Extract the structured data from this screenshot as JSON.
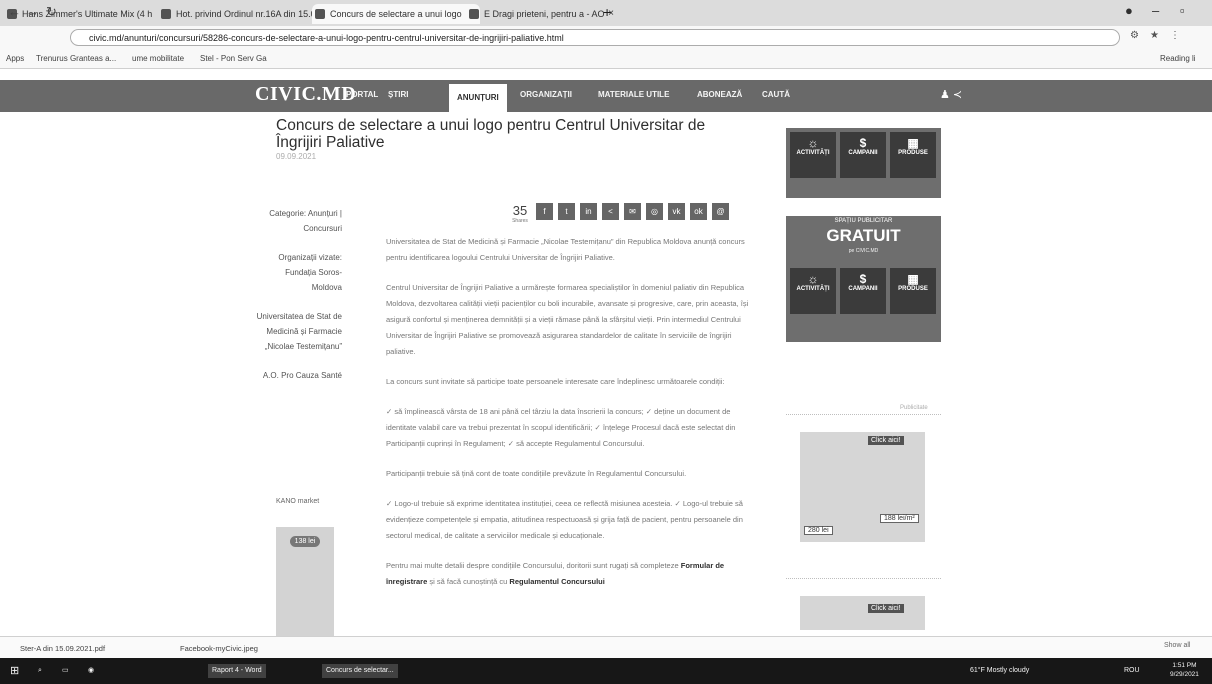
{
  "browser": {
    "tabs": [
      {
        "label": "Hans Zimmer's Ultimate Mix (4 h"
      },
      {
        "label": "Hot. privind Ordinul nr.16A din 15.0"
      },
      {
        "label": "Concurs de selectare a unui logo"
      },
      {
        "label": "E Dragi prieteni, pentru a - AO"
      }
    ],
    "new_tab": "+",
    "url": "civic.md/anunturi/concursuri/58286-concurs-de-selectare-a-unui-logo-pentru-centrul-universitar-de-ingrijiri-paliative.html",
    "bookmarks": [
      "Apps",
      "Trenurus Granteas a...",
      "ume mobilitate",
      "Stel - Pon Serv Ga"
    ],
    "reading_list": "Reading li"
  },
  "site": {
    "logo": "CIVIC.MD",
    "nav": [
      "PORTAL",
      "ȘTIRI",
      "ANUNȚURI",
      "ORGANIZAȚII",
      "MATERIALE UTILE",
      "ABONEAZĂ",
      "CAUTĂ"
    ],
    "icons": "♟ ≺"
  },
  "article": {
    "title": "Concurs de selectare a unui logo pentru Centrul Universitar de Îngrijiri Paliative",
    "date": "09.09.2021",
    "meta": [
      {
        "text": "Categorie: Anunțuri | Concursuri"
      },
      {
        "text": "Organizații vizate: Fundația Soros-Moldova"
      },
      {
        "text": "Universitatea de Stat de Medicină și Farmacie „Nicolae Testemițanu”"
      },
      {
        "text": "A.O. Pro Cauza Santé"
      }
    ],
    "share_count": "35",
    "share_label": "Shares",
    "share_buttons": [
      "f",
      "t",
      "in",
      "<",
      "✉",
      "◎",
      "vk",
      "ok",
      "@"
    ],
    "paragraphs": [
      "Universitatea de Stat de Medicină și Farmacie „Nicolae Testemițanu” din Republica Moldova anunță concurs pentru identificarea logoului Centrului Universitar de Îngrijiri Paliative.",
      "Centrul Universitar de Îngrijiri Paliative a urmărește formarea specialiștilor în domeniul paliativ din Republica Moldova, dezvoltarea calității vieții pacienților cu boli incurabile, avansate și progresive, care, prin aceasta, își asigură confortul și menținerea demnității și a vieții rămase până la sfârșitul vieții. Prin intermediul Centrului Universitar de Îngrijiri Paliative se promovează asigurarea standardelor de calitate în serviciile de îngrijiri paliative.",
      "La concurs sunt invitate să participe toate persoanele interesate care îndeplinesc următoarele condiții:",
      "✓ să împlinească vârsta de 18 ani până cel târziu la data înscrierii la concurs; ✓ deține un document de identitate valabil care va trebui prezentat în scopul identificării; ✓ înțelege Procesul dacă este selectat din Participanții cuprinși în Regulament; ✓ să accepte Regulamentul Concursului.",
      "Participanții trebuie să țină cont de toate condițiile prevăzute în Regulamentul Concursului.",
      "✓ Logo-ul trebuie să exprime identitatea instituției, ceea ce reflectă misiunea acesteia. ✓ Logo-ul trebuie să evidențieze competențele și empatia, atitudinea respectuoasă și grija față de pacient, pentru persoanele din sectorul medical, de calitate a serviciilor medicale și educaționale."
    ],
    "closing_pre": "Pentru mai multe detalii despre condițiile Concursului, doritorii sunt rugați să completeze ",
    "closing_link1": "Formular de înregistrare",
    "closing_mid": " și să facă cunoștință cu ",
    "closing_link2": "Regulamentul Concursului"
  },
  "ads": {
    "top_cards": [
      "ACTIVITĂȚI",
      "CAMPANII",
      "PRODUSE"
    ],
    "promo_head": "SPAȚIU PUBLICITAR",
    "promo_big": "GRATUIT",
    "promo_small": "pe CIVIC.MD",
    "left_logo": "KANO market",
    "left_price": "138 lei",
    "right_label1": "Click aici!",
    "right_price1": "280 lei",
    "right_price2": "188 lei/m²",
    "right_label2": "Click aici!",
    "section_label": "Publicitate",
    "show_all": "Show all"
  },
  "downloads": [
    {
      "name": "Ster-A din 15.09.2021.pdf"
    },
    {
      "name": "Facebook-myCivic.jpeg"
    }
  ],
  "taskbar": {
    "items": [
      "Raport 4 - Word",
      "Concurs de selectar..."
    ],
    "weather": "61°F Mostly cloudy",
    "lang": "ROU",
    "time": "1:51 PM",
    "date": "9/29/2021"
  }
}
